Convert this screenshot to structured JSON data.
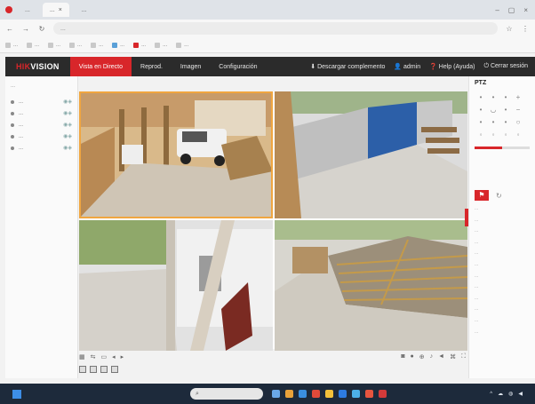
{
  "browser": {
    "tabs": [
      {
        "label": "..."
      },
      {
        "label": "..."
      },
      {
        "label": "..."
      }
    ],
    "url": "...",
    "bookmarks": [
      "...",
      "...",
      "...",
      "...",
      "...",
      "...",
      "...",
      "...",
      "..."
    ]
  },
  "app": {
    "logo_main": "HIK",
    "logo_rest": "VISION",
    "nav": [
      "Vista en Directo",
      "Reprod.",
      "Imagen",
      "Configuración"
    ],
    "right_nav": [
      "Descargar complemento",
      "admin",
      "Help (Ayuda)",
      "Cerrar sesión"
    ]
  },
  "left_panel": {
    "heading": "...",
    "cameras": [
      "...",
      "...",
      "...",
      "...",
      "..."
    ]
  },
  "grid": {
    "cells": [
      {
        "label": "",
        "timestamp": ""
      },
      {
        "label": "",
        "timestamp": ""
      },
      {
        "label": "",
        "timestamp": ""
      },
      {
        "label": "",
        "timestamp": ""
      }
    ]
  },
  "ptz": {
    "title": "PTZ",
    "presets": [
      "...",
      "...",
      "...",
      "...",
      "...",
      "...",
      "...",
      "...",
      "...",
      "...",
      "...",
      "..."
    ]
  },
  "taskbar": {
    "search_placeholder": "",
    "tray_time": "",
    "tray_date": ""
  },
  "colors": {
    "accent": "#d8262a",
    "appbar": "#2b2b2b",
    "taskbar": "#1d2a3b"
  }
}
